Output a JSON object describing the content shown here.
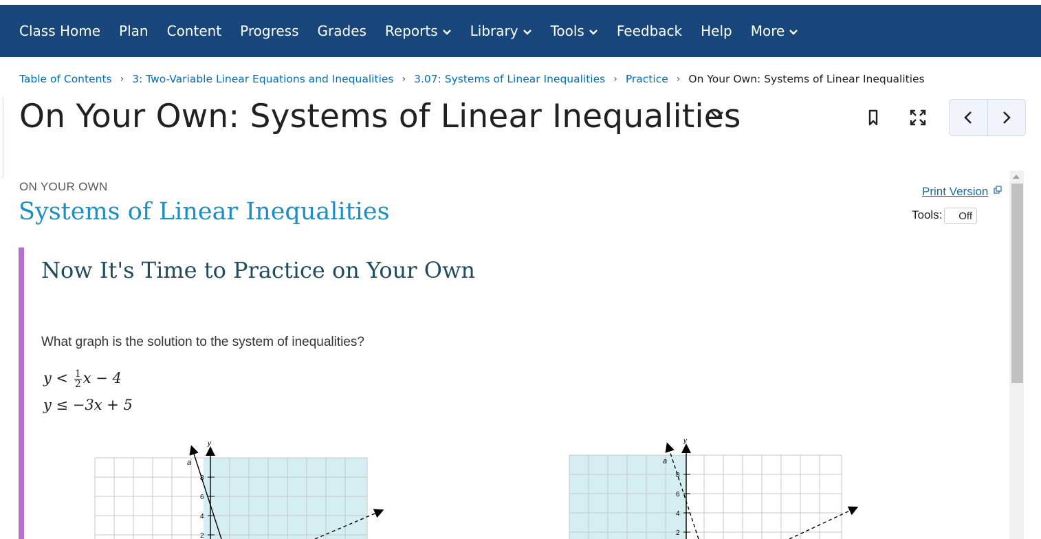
{
  "nav": {
    "items": [
      {
        "label": "Class Home",
        "dropdown": false
      },
      {
        "label": "Plan",
        "dropdown": false
      },
      {
        "label": "Content",
        "dropdown": false
      },
      {
        "label": "Progress",
        "dropdown": false
      },
      {
        "label": "Grades",
        "dropdown": false
      },
      {
        "label": "Reports",
        "dropdown": true
      },
      {
        "label": "Library",
        "dropdown": true
      },
      {
        "label": "Tools",
        "dropdown": true
      },
      {
        "label": "Feedback",
        "dropdown": false
      },
      {
        "label": "Help",
        "dropdown": false
      },
      {
        "label": "More",
        "dropdown": true
      }
    ],
    "background": "#18467a"
  },
  "breadcrumb": {
    "links": [
      "Table of Contents",
      "3: Two-Variable Linear Equations and Inequalities",
      "3.07: Systems of Linear Inequalities",
      "Practice"
    ],
    "current": "On Your Own: Systems of Linear Inequalities"
  },
  "page": {
    "title": "On Your Own: Systems of Linear Inequalities"
  },
  "content": {
    "overline": "ON YOUR OWN",
    "section_title": "Systems of Linear Inequalities",
    "print_label": "Print Version",
    "tools_label": "Tools:",
    "tools_toggle": "Off",
    "callout_title": "Now It's Time to Practice on Your Own",
    "question": "What graph is the solution to the system of inequalities?",
    "equations": {
      "eq1_left": "y <",
      "eq1_num": "1",
      "eq1_den": "2",
      "eq1_right": "x − 4",
      "eq2": "y ≤ −3x + 5"
    }
  },
  "graphs": {
    "axis_y_label": "y",
    "line_label": "a",
    "y_ticks": [
      "8",
      "6",
      "4",
      "2"
    ],
    "shade_color": "#d4eef1",
    "accent_color": "#b46fd1"
  }
}
